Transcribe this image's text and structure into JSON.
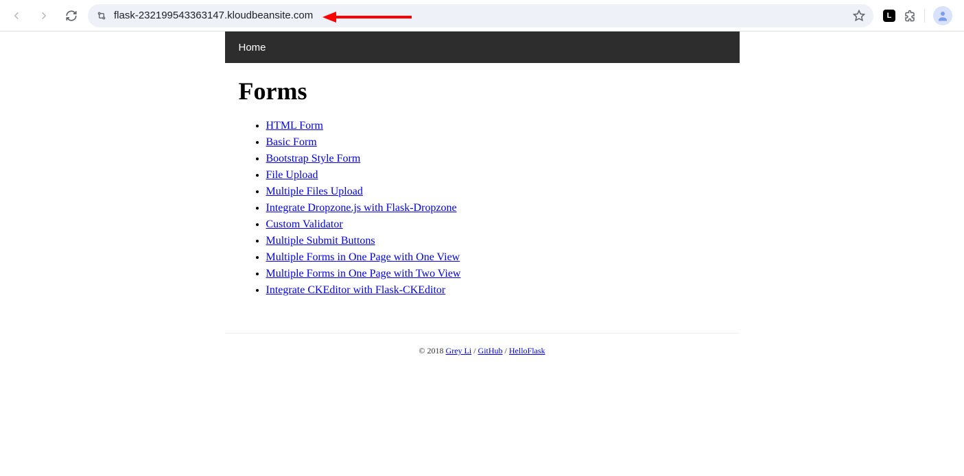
{
  "browser": {
    "url": "flask-232199543363147.kloudbeansite.com"
  },
  "nav": {
    "home": "Home"
  },
  "page": {
    "heading": "Forms",
    "links": [
      "HTML Form",
      "Basic Form",
      "Bootstrap Style Form",
      "File Upload",
      "Multiple Files Upload",
      "Integrate Dropzone.js with Flask-Dropzone",
      "Custom Validator",
      "Multiple Submit Buttons",
      "Multiple Forms in One Page with One View",
      "Multiple Forms in One Page with Two View",
      "Integrate CKEditor with Flask-CKEditor"
    ]
  },
  "footer": {
    "copyright": "© 2018 ",
    "author": "Grey Li",
    "sep": " / ",
    "github": "GitHub",
    "helloflask": "HelloFlask"
  }
}
